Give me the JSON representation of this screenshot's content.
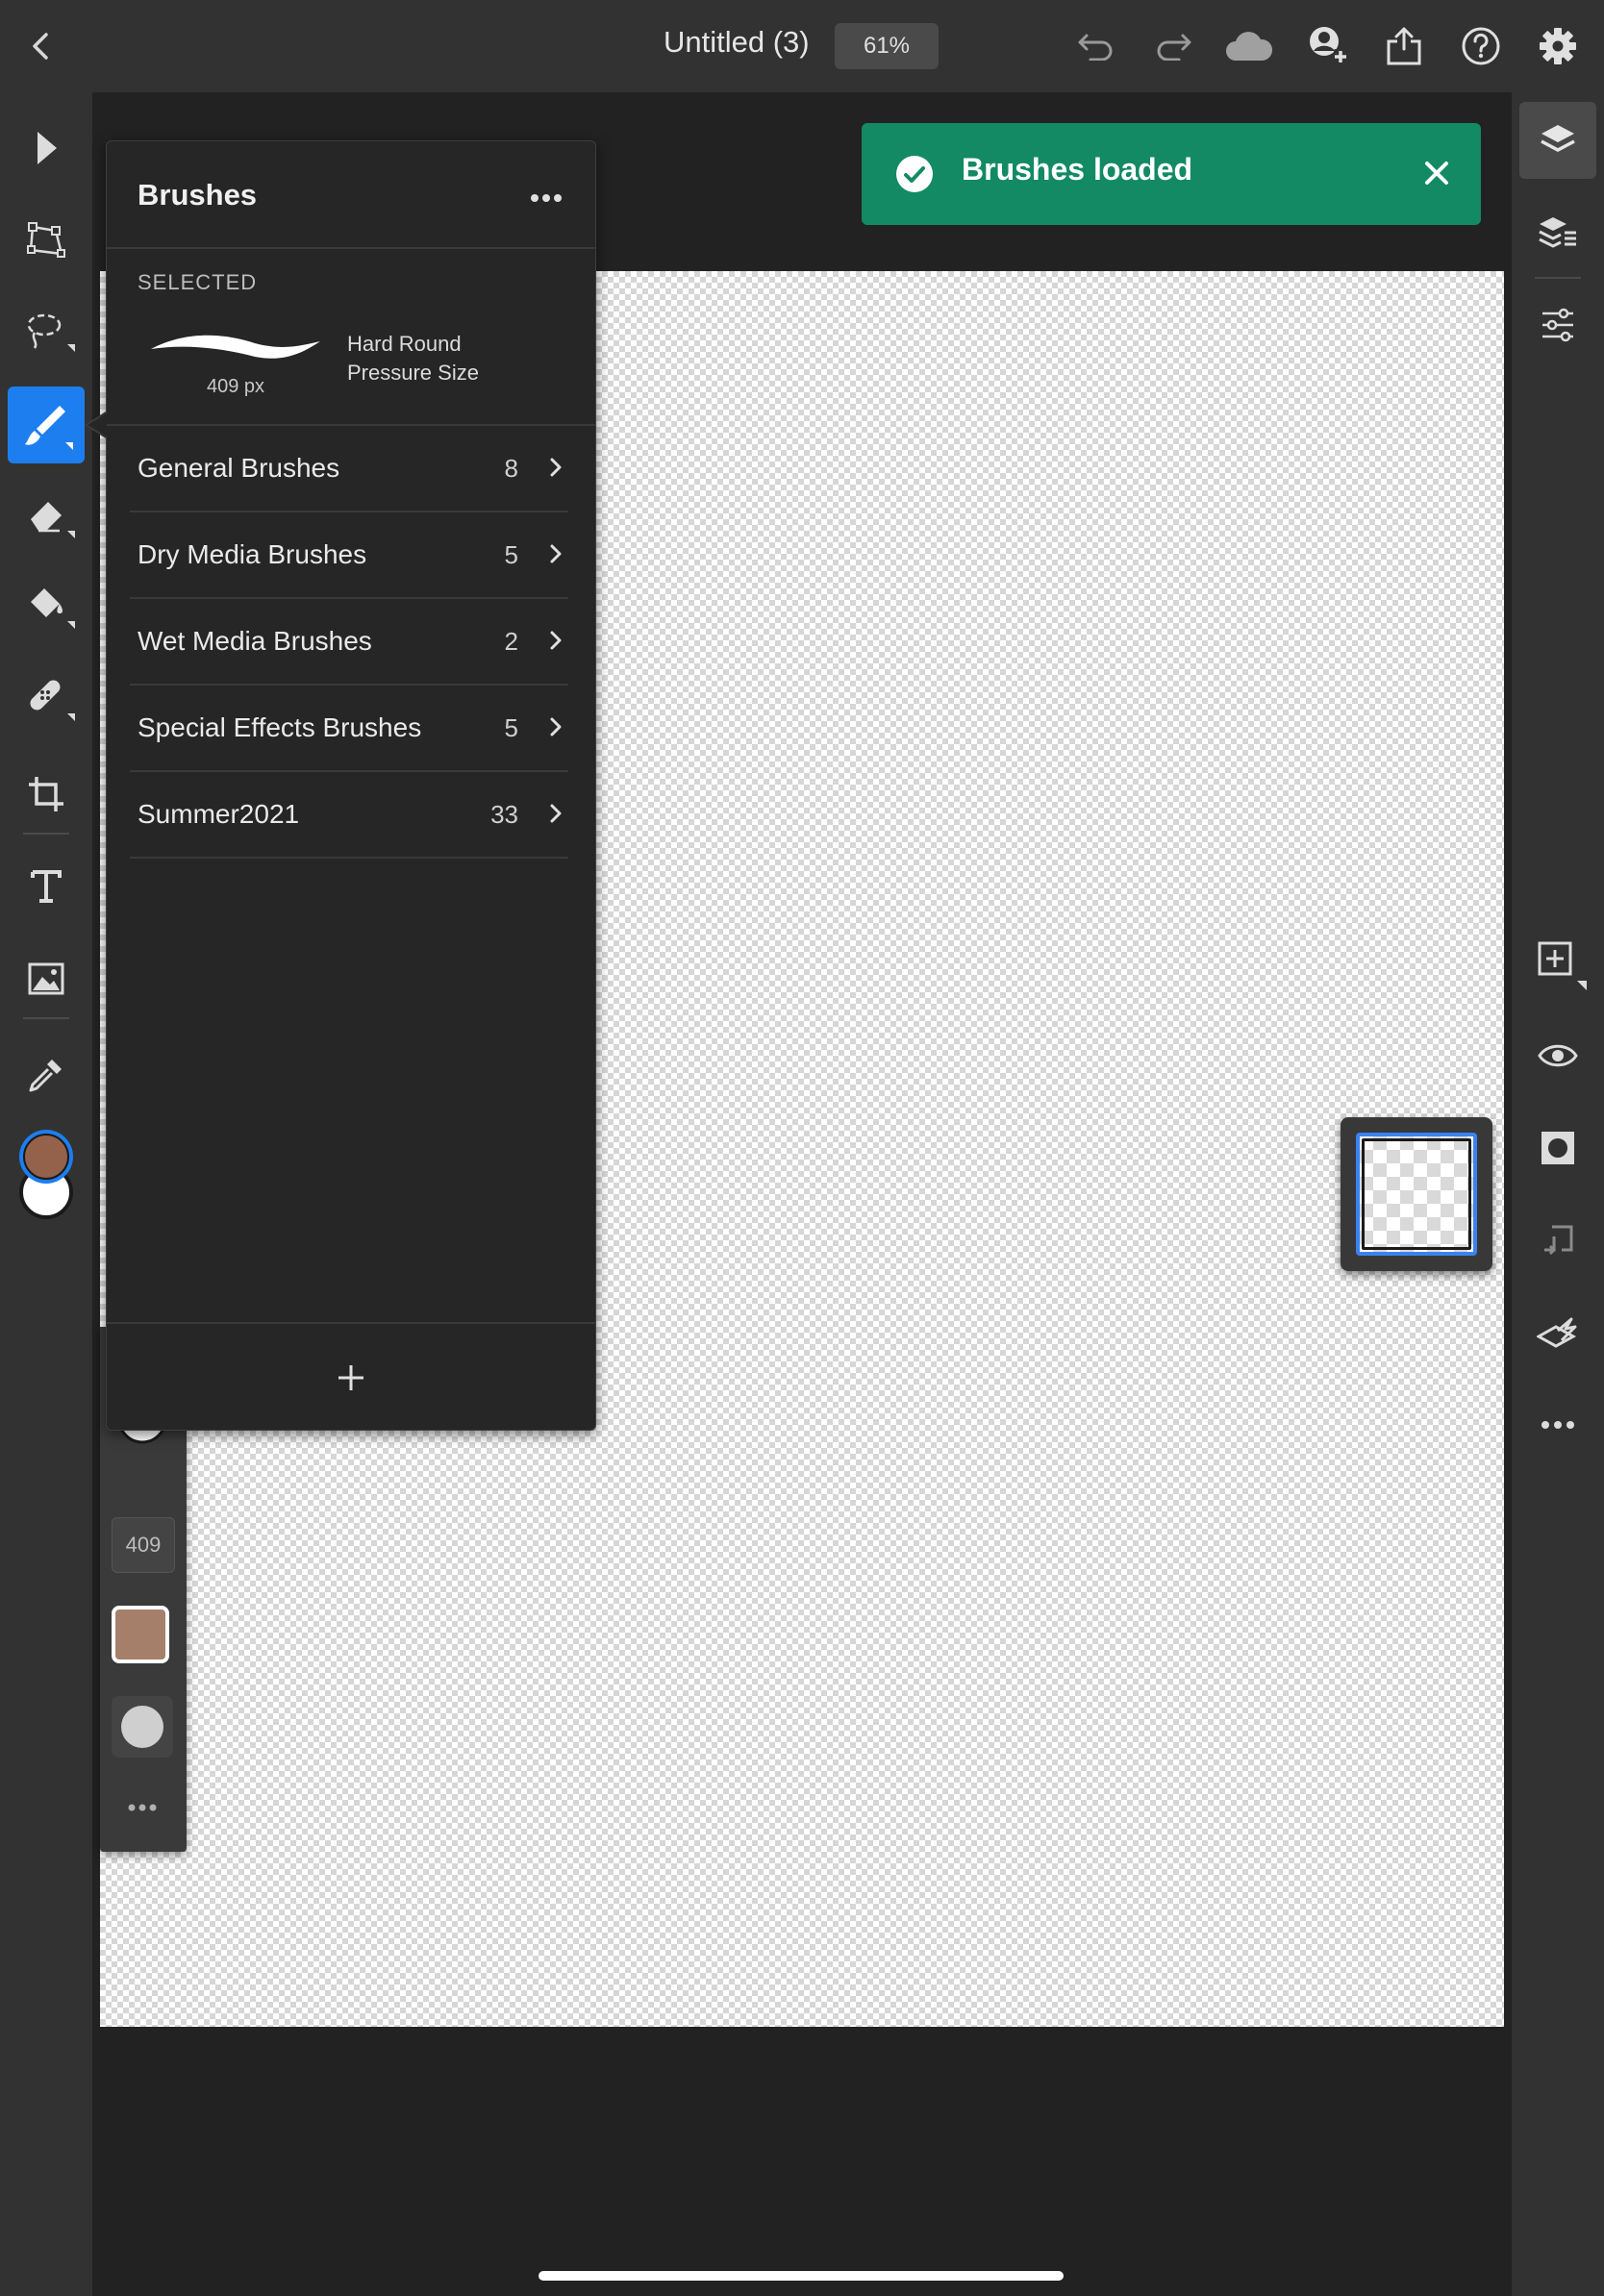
{
  "header": {
    "document_title": "Untitled (3)",
    "zoom_level": "61%"
  },
  "toast": {
    "message": "Brushes loaded"
  },
  "brushes_panel": {
    "title": "Brushes",
    "selected_label": "SELECTED",
    "selected_brush": {
      "size": "409 px",
      "name_line1": "Hard Round",
      "name_line2": "Pressure Size"
    },
    "categories": [
      {
        "label": "General Brushes",
        "count": "8"
      },
      {
        "label": "Dry Media Brushes",
        "count": "5"
      },
      {
        "label": "Wet Media Brushes",
        "count": "2"
      },
      {
        "label": "Special Effects Brushes",
        "count": "5"
      },
      {
        "label": "Summer2021",
        "count": "33"
      }
    ]
  },
  "brush_strip": {
    "size_value": "409"
  },
  "colors": {
    "accent": "#1d7ef0",
    "toast_bg": "#138a64",
    "foreground_color": "#94624a",
    "background_color": "#ffffff",
    "brush_tint": "#a67f6a"
  },
  "icons": {
    "left_toolbar": [
      "select-icon",
      "transform-icon",
      "lasso-icon",
      "brush-icon",
      "eraser-icon",
      "paint-bucket-icon",
      "healing-icon",
      "crop-icon",
      "type-icon",
      "image-icon",
      "eyedropper-icon"
    ],
    "right_toolbar": [
      "layers-icon",
      "layer-properties-icon",
      "adjustments-icon",
      "add-layer-icon",
      "visibility-icon",
      "mask-icon",
      "merge-down-icon",
      "clipping-icon",
      "more-icon"
    ],
    "top_bar": [
      "back-icon",
      "undo-icon",
      "redo-icon",
      "cloud-icon",
      "invite-icon",
      "share-icon",
      "help-icon",
      "settings-icon"
    ]
  }
}
